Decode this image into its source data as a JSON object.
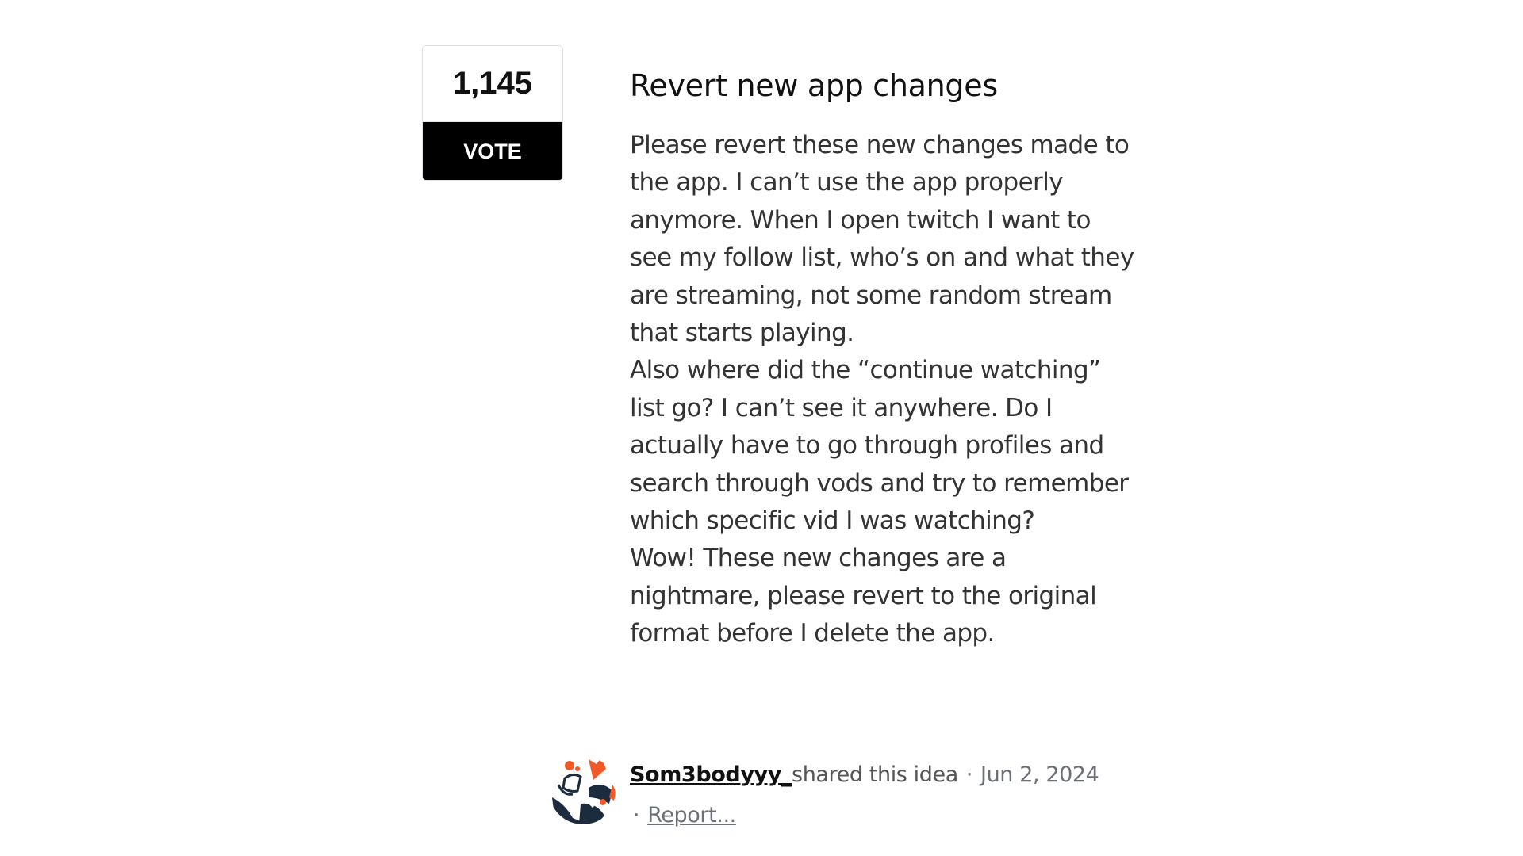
{
  "idea": {
    "votes": "1,145",
    "vote_label": "VOTE",
    "title": "Revert new app changes",
    "paragraphs": [
      "Please revert these new changes made to the app. I can’t use the app properly anymore. When I open twitch I want to see my follow list, who’s on and what they are streaming, not some random stream that starts playing.",
      "Also where did the “continue watching” list go? I can’t see it anywhere. Do I actually have to go through profiles and search through vods and try to remember which specific vid I was watching?",
      "Wow! These new changes are a nightmare, please revert to the original format before I delete the app."
    ]
  },
  "author": {
    "name": "Som3bodyyy_",
    "shared_text": "shared this idea",
    "separator": "·",
    "date": "Jun 2, 2024",
    "avatar_icon": "user-avatar-illustration",
    "avatar_colors": {
      "dark": "#1c2b3e",
      "accent": "#f05a28"
    }
  },
  "actions": {
    "separator": "·",
    "report_label": "Report..."
  }
}
